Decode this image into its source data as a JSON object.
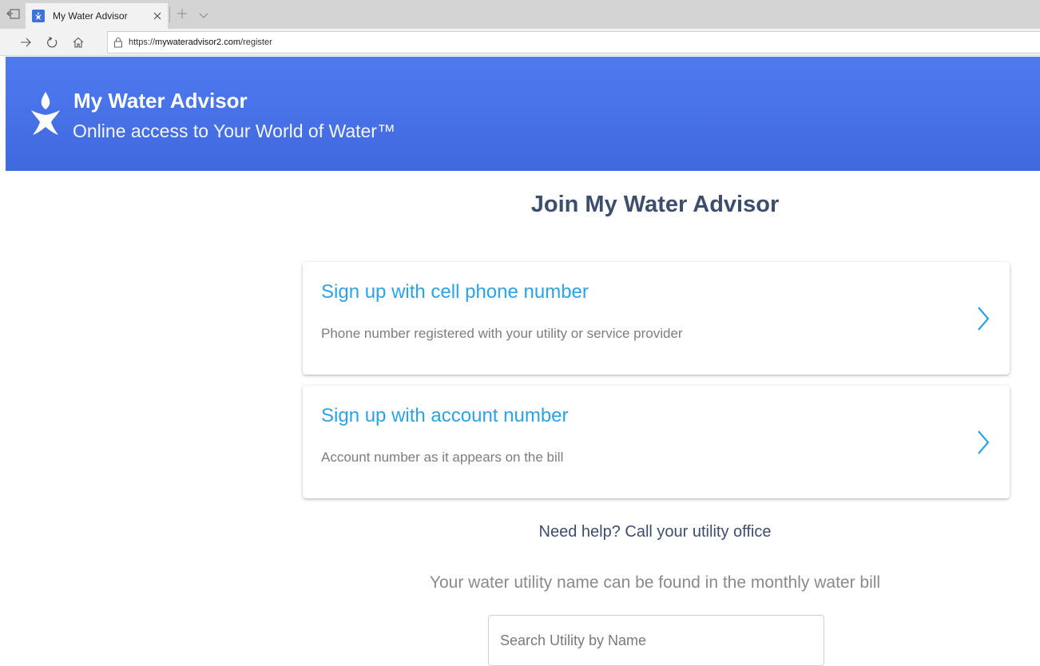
{
  "browser": {
    "tab": {
      "title": "My Water Advisor"
    },
    "address": {
      "scheme": "https://",
      "host": "mywateradvisor2.com",
      "path": "/register"
    }
  },
  "header": {
    "title": "My Water Advisor",
    "subtitle": "Online access to Your World of Water™"
  },
  "main": {
    "title": "Join My Water Advisor",
    "options": [
      {
        "title": "Sign up with cell phone number",
        "description": "Phone number registered with your utility or service provider"
      },
      {
        "title": "Sign up with account number",
        "description": "Account number as it appears on the bill"
      }
    ],
    "help_text": "Need help? Call your utility office",
    "utility_hint": "Your water utility name can be found in the monthly water bill",
    "search": {
      "placeholder": "Search Utility by Name",
      "value": ""
    }
  },
  "colors": {
    "header_blue": "#4a74ea",
    "accent_blue": "#2ba3e6",
    "heading_navy": "#3d4e6d",
    "muted_gray": "#7d7d7d"
  },
  "icons": {
    "logo": "water-drop-person-icon",
    "card_action": "chevron-right-icon",
    "back": "arrow-right-icon",
    "refresh": "refresh-icon",
    "home": "home-icon",
    "lock": "lock-icon"
  }
}
